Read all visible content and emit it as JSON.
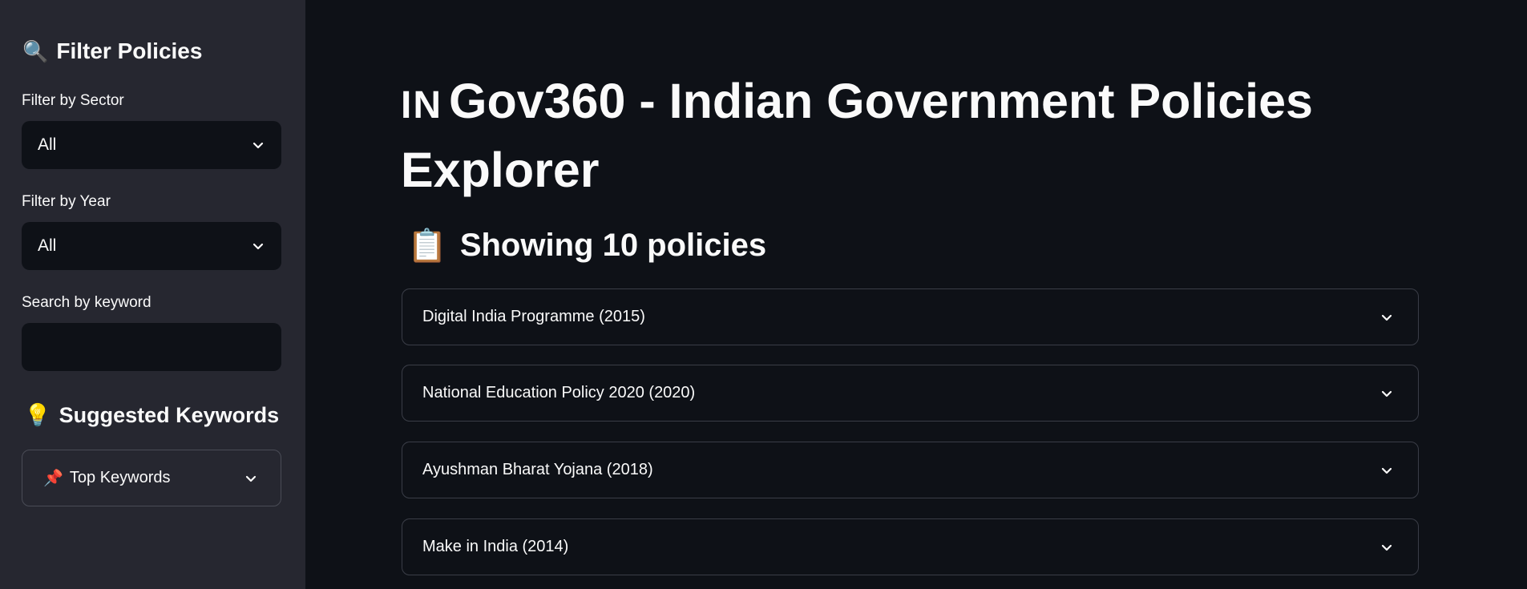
{
  "sidebar": {
    "title": "Filter Policies",
    "title_icon": "magnifier-icon",
    "sector": {
      "label": "Filter by Sector",
      "value": "All"
    },
    "year": {
      "label": "Filter by Year",
      "value": "All"
    },
    "search": {
      "label": "Search by keyword",
      "value": "",
      "placeholder": ""
    },
    "suggested": {
      "title": "Suggested Keywords",
      "icon": "lightbulb-icon"
    },
    "top_keywords": {
      "label": "Top Keywords",
      "icon": "pushpin-icon"
    }
  },
  "main": {
    "flag_text": "IN",
    "title": "Gov360 - Indian Government Policies Explorer",
    "count_title": "Showing 10 policies",
    "count_icon": "clipboard-icon",
    "policies": [
      "Digital India Programme (2015)",
      "National Education Policy 2020 (2020)",
      "Ayushman Bharat Yojana (2018)",
      "Make in India (2014)"
    ]
  },
  "colors": {
    "background": "#0e1117",
    "sidebar": "#262730",
    "text": "#fafafa",
    "border": "#3a3d47"
  }
}
